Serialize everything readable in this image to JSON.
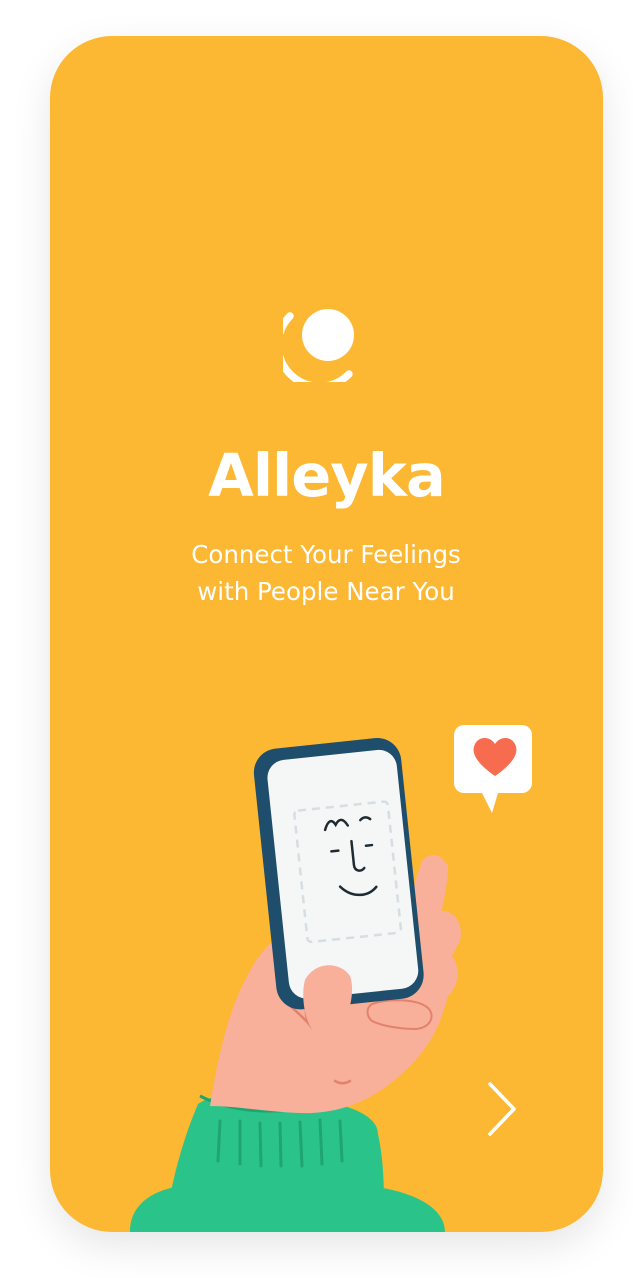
{
  "colors": {
    "background": "#FCB733",
    "text": "#FFFFFF",
    "sweater": "#2AC48A",
    "phone_case": "#1E4E6B",
    "skin": "#F9B09A",
    "heart": "#F76B4F"
  },
  "logo": {
    "icon": "moon-logo-icon"
  },
  "app": {
    "title": "Alleyka",
    "tagline_line1": "Connect Your Feelings",
    "tagline_line2": "with People Near You"
  },
  "navigation": {
    "next_icon": "chevron-right-icon"
  }
}
